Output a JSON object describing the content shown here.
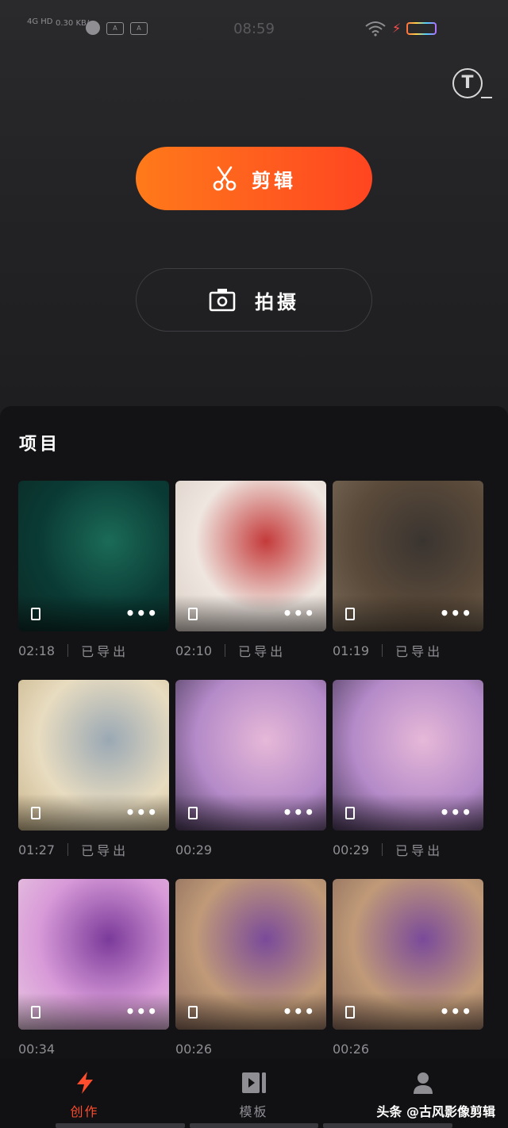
{
  "status_bar": {
    "network": "4G HD",
    "speed": "0.30 KB/s",
    "time": "08:59",
    "badges": [
      "A",
      "A"
    ],
    "battery_label": ""
  },
  "text_tool": {
    "icon": "text-icon",
    "label": "T"
  },
  "actions": {
    "edit": {
      "label": "剪辑",
      "icon": "scissors-icon"
    },
    "shoot": {
      "label": "拍摄",
      "icon": "camera-icon"
    }
  },
  "projects": {
    "title": "项目",
    "items": [
      {
        "duration": "02:18",
        "status": "已导出",
        "colors": [
          "#0a3a34",
          "#1b6b58",
          "#0c2a26"
        ]
      },
      {
        "duration": "02:10",
        "status": "已导出",
        "colors": [
          "#efe6e0",
          "#c43a3a",
          "#d9cfc6"
        ]
      },
      {
        "duration": "01:19",
        "status": "已导出",
        "colors": [
          "#5a4a3a",
          "#3a3430",
          "#7a6a58"
        ]
      },
      {
        "duration": "01:27",
        "status": "已导出",
        "colors": [
          "#e8dcc0",
          "#9aa8b4",
          "#c8b48a"
        ]
      },
      {
        "duration": "00:29",
        "status": "",
        "colors": [
          "#b48ac8",
          "#e6b8d8",
          "#4a3a5a"
        ]
      },
      {
        "duration": "00:29",
        "status": "已导出",
        "colors": [
          "#b48ac8",
          "#e6b8d8",
          "#4a3a5a"
        ]
      },
      {
        "duration": "00:34",
        "status": "",
        "colors": [
          "#d89ad8",
          "#7a3a9a",
          "#e8c8e0"
        ]
      },
      {
        "duration": "00:26",
        "status": "",
        "colors": [
          "#c09a78",
          "#7a4a9a",
          "#8a6a5a"
        ]
      },
      {
        "duration": "00:26",
        "status": "",
        "colors": [
          "#c09a78",
          "#7a4a9a",
          "#8a6a5a"
        ]
      }
    ]
  },
  "tabs": [
    {
      "label": "创作",
      "icon": "lightning-icon",
      "active": true,
      "color": "#ff4d2d"
    },
    {
      "label": "模板",
      "icon": "template-icon",
      "active": false,
      "color": "#8e8e93"
    },
    {
      "label": "",
      "icon": "user-icon",
      "active": false,
      "color": "#8e8e93"
    }
  ],
  "watermark": "头条 @古风影像剪辑"
}
